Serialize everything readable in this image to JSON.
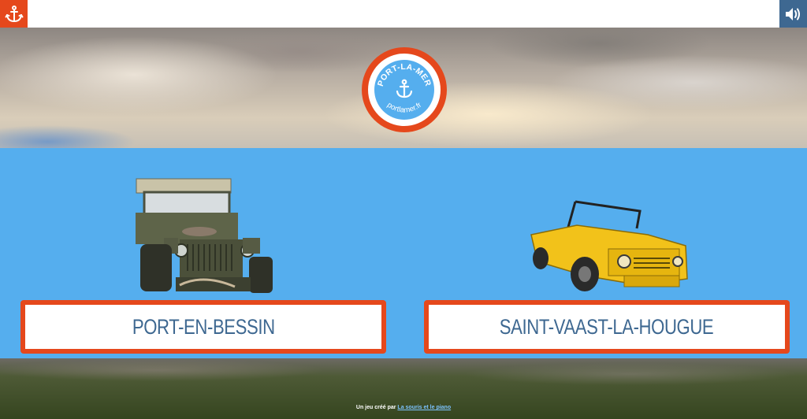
{
  "topbar": {
    "home_icon": "anchor-icon",
    "sound_icon": "speaker-icon",
    "accent_color": "#e5481c",
    "sound_color": "#3e6891"
  },
  "logo": {
    "top_text": "PORT-LA-MER",
    "bottom_text": "portlamer.fr",
    "icon": "anchor-icon"
  },
  "choices": [
    {
      "label": "PORT-EN-BESSIN",
      "image": "military-jeep"
    },
    {
      "label": "SAINT-VAAST-LA-HOUGUE",
      "image": "yellow-mehari-car"
    }
  ],
  "footer": {
    "prefix": "Un jeu créé par",
    "link": "La souris et le piano"
  },
  "colors": {
    "background_blue": "#55aeee",
    "button_text": "#3e6891",
    "button_border": "#e5481c"
  }
}
